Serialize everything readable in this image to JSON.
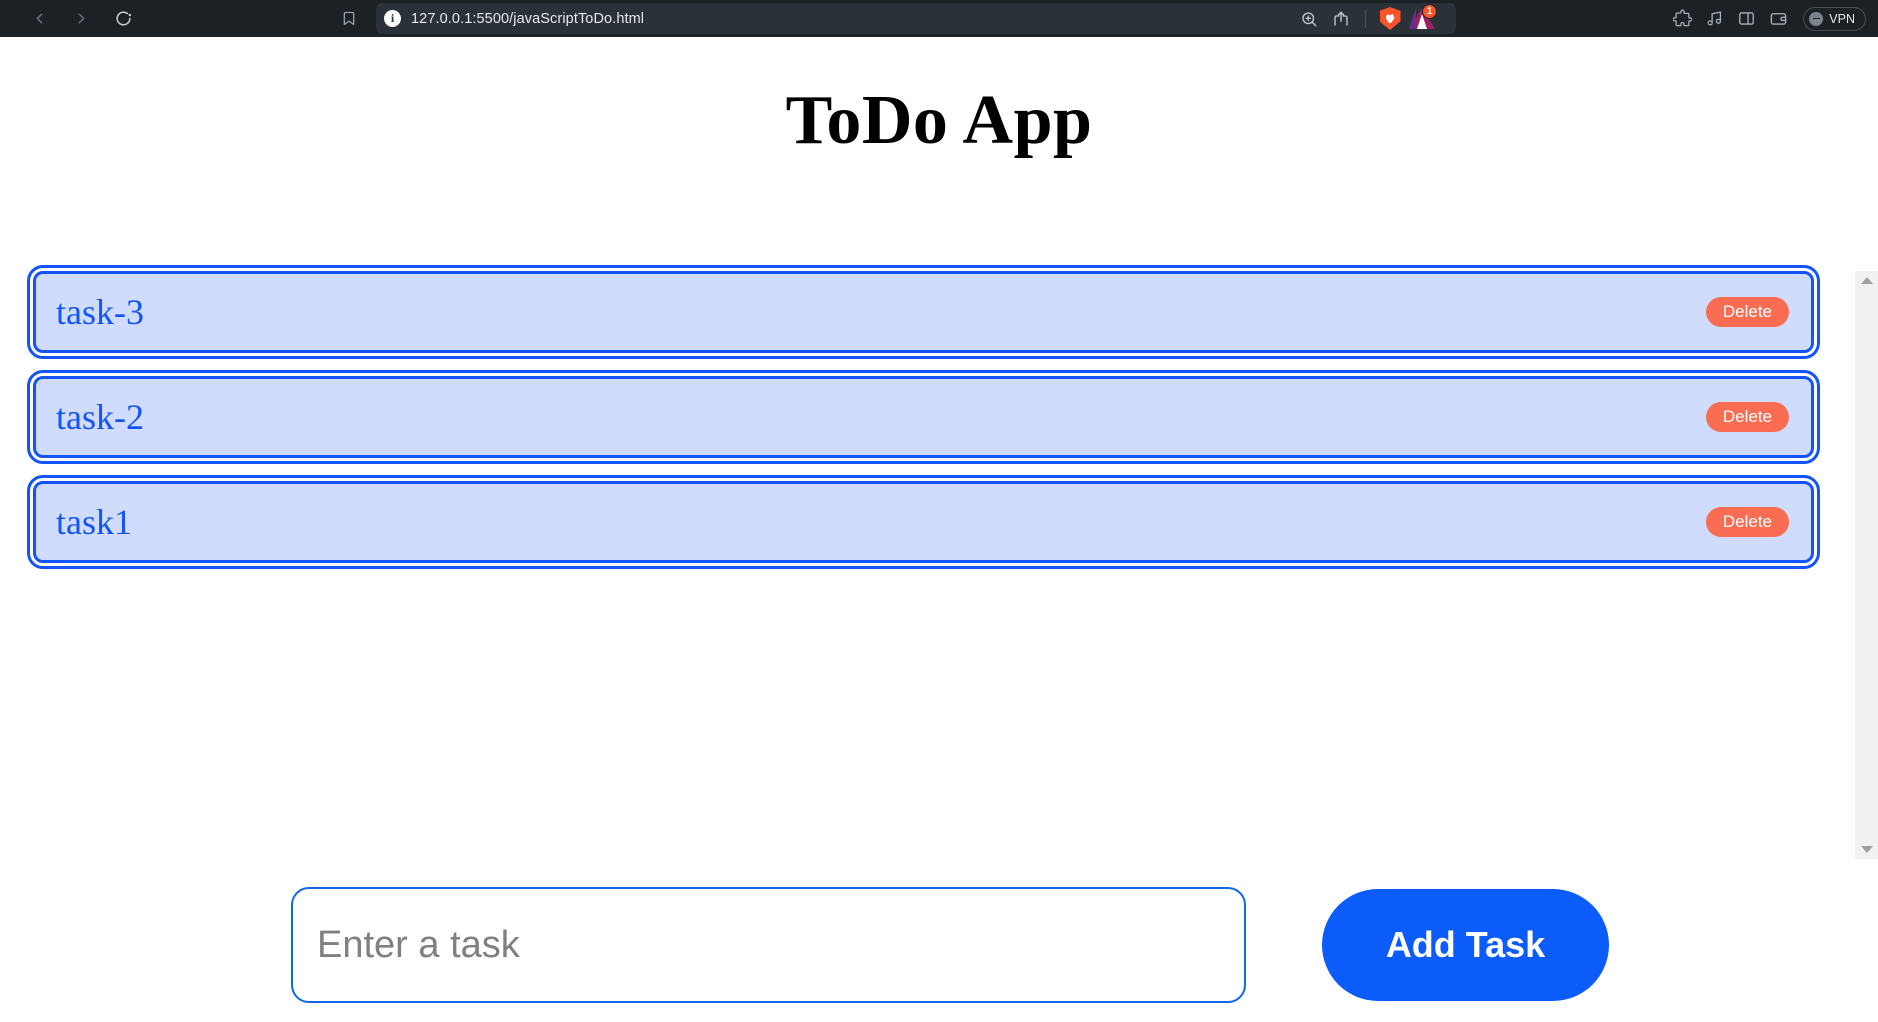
{
  "browser": {
    "nav": {
      "back_icon": "chevron-left-icon",
      "forward_icon": "chevron-right-icon",
      "reload_icon": "reload-icon"
    },
    "bookmark_icon": "bookmark-icon",
    "omnibox": {
      "info_icon": "info-icon",
      "info_glyph": "i",
      "url": "127.0.0.1:5500/javaScriptToDo.html",
      "zoom_icon": "zoom-in-icon",
      "share_icon": "share-icon",
      "shield_icon": "brave-shield-icon",
      "rewards_icon": "brave-rewards-triangle-icon",
      "rewards_badge": "1"
    },
    "right_icons": [
      {
        "name": "extensions-puzzle-icon",
        "glyph": "puzzle"
      },
      {
        "name": "music-note-icon",
        "glyph": "music"
      },
      {
        "name": "sidebar-panel-icon",
        "glyph": "panel"
      },
      {
        "name": "wallet-icon",
        "glyph": "wallet"
      }
    ],
    "vpn": {
      "label": "VPN",
      "icon": "vpn-toggle-icon"
    },
    "colors": {
      "toolbar_bg": "#1c2126",
      "omnibox_bg": "#2b3138",
      "brave_orange": "#fb542b"
    }
  },
  "page": {
    "title": "ToDo App",
    "tasks": [
      {
        "label": "task-3",
        "delete_label": "Delete"
      },
      {
        "label": "task-2",
        "delete_label": "Delete"
      },
      {
        "label": "task1",
        "delete_label": "Delete"
      }
    ],
    "compose": {
      "input_value": "",
      "input_placeholder": "Enter a task",
      "add_button_label": "Add Task"
    },
    "scrollbar": {
      "up_arrow_icon": "scroll-up-arrow-icon",
      "down_arrow_icon": "scroll-down-arrow-icon"
    },
    "colors": {
      "accent_blue": "#1353f8",
      "task_bg": "#cfdcfd",
      "delete_red": "#fb6d52",
      "add_button_blue": "#0b5cfb",
      "placeholder_gray": "#808080"
    }
  }
}
